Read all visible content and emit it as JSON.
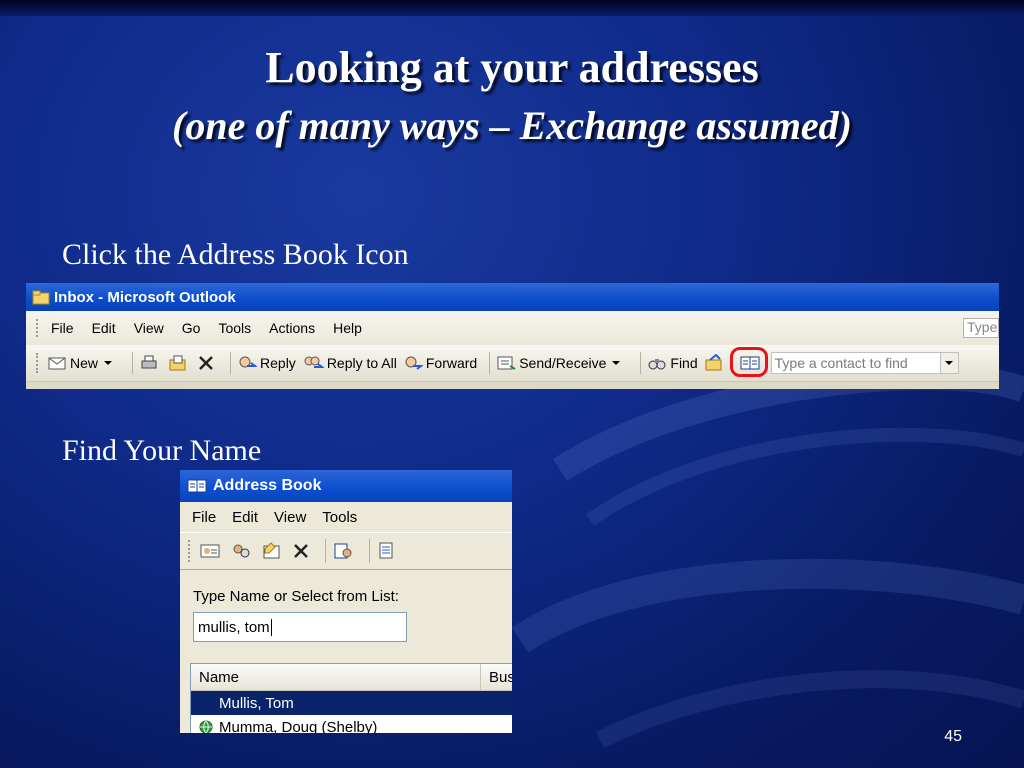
{
  "slide": {
    "title_line1": "Looking at your addresses",
    "title_line2": "(one of many ways – Exchange assumed)",
    "caption1": "Click the Address Book Icon",
    "caption2": "Find Your Name",
    "slide_number": "45",
    "background_color": "#0f2a88"
  },
  "outlook": {
    "window_title": "Inbox - Microsoft Outlook",
    "menu": [
      "File",
      "Edit",
      "View",
      "Go",
      "Tools",
      "Actions",
      "Help"
    ],
    "help_box_text": "Type",
    "toolbar": {
      "new_label": "New",
      "reply_label": "Reply",
      "reply_all_label": "Reply to All",
      "forward_label": "Forward",
      "send_receive_label": "Send/Receive",
      "find_label": "Find",
      "contact_search_placeholder": "Type a contact to find"
    },
    "highlight_color": "#e8111a"
  },
  "address_book": {
    "window_title": "Address Book",
    "menu": [
      "File",
      "Edit",
      "View",
      "Tools"
    ],
    "search_label": "Type Name or Select from List:",
    "search_value": "mullis, tom",
    "columns": [
      "Name",
      "Bus"
    ],
    "rows": [
      {
        "name": "Mullis, Tom",
        "selected": true
      },
      {
        "name": "Mumma, Doug (Shelby)",
        "selected": false
      }
    ]
  }
}
